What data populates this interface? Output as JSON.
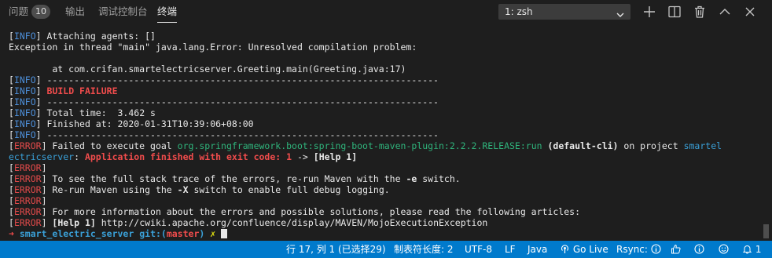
{
  "panel": {
    "tabs": [
      {
        "label": "问题",
        "badge": "10"
      },
      {
        "label": "输出"
      },
      {
        "label": "调试控制台"
      },
      {
        "label": "终端"
      }
    ],
    "terminal_select": "1: zsh"
  },
  "terminal": {
    "lines": [
      [
        {
          "t": "[",
          "c": "white"
        },
        {
          "t": "INFO",
          "c": "info"
        },
        {
          "t": "] Attaching agents: []",
          "c": "white"
        }
      ],
      [
        {
          "t": "Exception in thread \"main\" java.lang.Error: Unresolved compilation problem:",
          "c": "white"
        }
      ],
      [
        {
          "t": "",
          "c": "white"
        }
      ],
      [
        {
          "t": "        at com.crifan.smartelectricserver.Greeting.main(Greeting.java:17)",
          "c": "white"
        }
      ],
      [
        {
          "t": "[",
          "c": "white"
        },
        {
          "t": "INFO",
          "c": "info"
        },
        {
          "t": "] ------------------------------------------------------------------------",
          "c": "white"
        }
      ],
      [
        {
          "t": "[",
          "c": "white"
        },
        {
          "t": "INFO",
          "c": "info"
        },
        {
          "t": "] ",
          "c": "white"
        },
        {
          "t": "BUILD FAILURE",
          "c": "red bold"
        }
      ],
      [
        {
          "t": "[",
          "c": "white"
        },
        {
          "t": "INFO",
          "c": "info"
        },
        {
          "t": "] ------------------------------------------------------------------------",
          "c": "white"
        }
      ],
      [
        {
          "t": "[",
          "c": "white"
        },
        {
          "t": "INFO",
          "c": "info"
        },
        {
          "t": "] Total time:  3.462 s",
          "c": "white"
        }
      ],
      [
        {
          "t": "[",
          "c": "white"
        },
        {
          "t": "INFO",
          "c": "info"
        },
        {
          "t": "] Finished at: 2020-01-31T10:39:06+08:00",
          "c": "white"
        }
      ],
      [
        {
          "t": "[",
          "c": "white"
        },
        {
          "t": "INFO",
          "c": "info"
        },
        {
          "t": "] ------------------------------------------------------------------------",
          "c": "white"
        }
      ],
      [
        {
          "t": "[",
          "c": "white"
        },
        {
          "t": "ERROR",
          "c": "err"
        },
        {
          "t": "] Failed to execute goal ",
          "c": "white"
        },
        {
          "t": "org.springframework.boot:spring-boot-maven-plugin:2.2.2.RELEASE:run",
          "c": "green"
        },
        {
          "t": " (default-cli)",
          "c": "white bold"
        },
        {
          "t": " on project ",
          "c": "white"
        },
        {
          "t": "smartel",
          "c": "cyan"
        }
      ],
      [
        {
          "t": "ectricserver",
          "c": "cyan"
        },
        {
          "t": ": ",
          "c": "white"
        },
        {
          "t": "Application finished with exit code: 1",
          "c": "red bold"
        },
        {
          "t": " -> ",
          "c": "white"
        },
        {
          "t": "[Help 1]",
          "c": "white bold"
        }
      ],
      [
        {
          "t": "[",
          "c": "white"
        },
        {
          "t": "ERROR",
          "c": "err"
        },
        {
          "t": "]",
          "c": "white"
        }
      ],
      [
        {
          "t": "[",
          "c": "white"
        },
        {
          "t": "ERROR",
          "c": "err"
        },
        {
          "t": "] To see the full stack trace of the errors, re-run Maven with the ",
          "c": "white"
        },
        {
          "t": "-e",
          "c": "white bold"
        },
        {
          "t": " switch.",
          "c": "white"
        }
      ],
      [
        {
          "t": "[",
          "c": "white"
        },
        {
          "t": "ERROR",
          "c": "err"
        },
        {
          "t": "] Re-run Maven using the ",
          "c": "white"
        },
        {
          "t": "-X",
          "c": "white bold"
        },
        {
          "t": " switch to enable full debug logging.",
          "c": "white"
        }
      ],
      [
        {
          "t": "[",
          "c": "white"
        },
        {
          "t": "ERROR",
          "c": "err"
        },
        {
          "t": "]",
          "c": "white"
        }
      ],
      [
        {
          "t": "[",
          "c": "white"
        },
        {
          "t": "ERROR",
          "c": "err"
        },
        {
          "t": "] For more information about the errors and possible solutions, please read the following articles:",
          "c": "white"
        }
      ],
      [
        {
          "t": "[",
          "c": "white"
        },
        {
          "t": "ERROR",
          "c": "err"
        },
        {
          "t": "] ",
          "c": "white"
        },
        {
          "t": "[Help 1]",
          "c": "white bold"
        },
        {
          "t": " http://cwiki.apache.org/confluence/display/MAVEN/MojoExecutionException",
          "c": "white"
        }
      ]
    ],
    "prompt": {
      "arrow": "➜",
      "dir": "smart_electric_server",
      "git_prefix": "git:(",
      "branch": "master",
      "git_suffix": ")",
      "dirty": "✗"
    }
  },
  "statusbar": {
    "position": "行 17, 列 1 (已选择29)",
    "tab_size": "制表符长度: 2",
    "encoding": "UTF-8",
    "eol": "LF",
    "language": "Java",
    "go_live": "Go Live",
    "rsync": "Rsync:",
    "notifications": "1"
  },
  "icons": {
    "chevron": "chevron-down-icon",
    "add": "plus-icon",
    "split": "split-terminal-icon",
    "trash": "trash-icon",
    "maximize": "chevron-up-icon",
    "close": "close-icon"
  }
}
